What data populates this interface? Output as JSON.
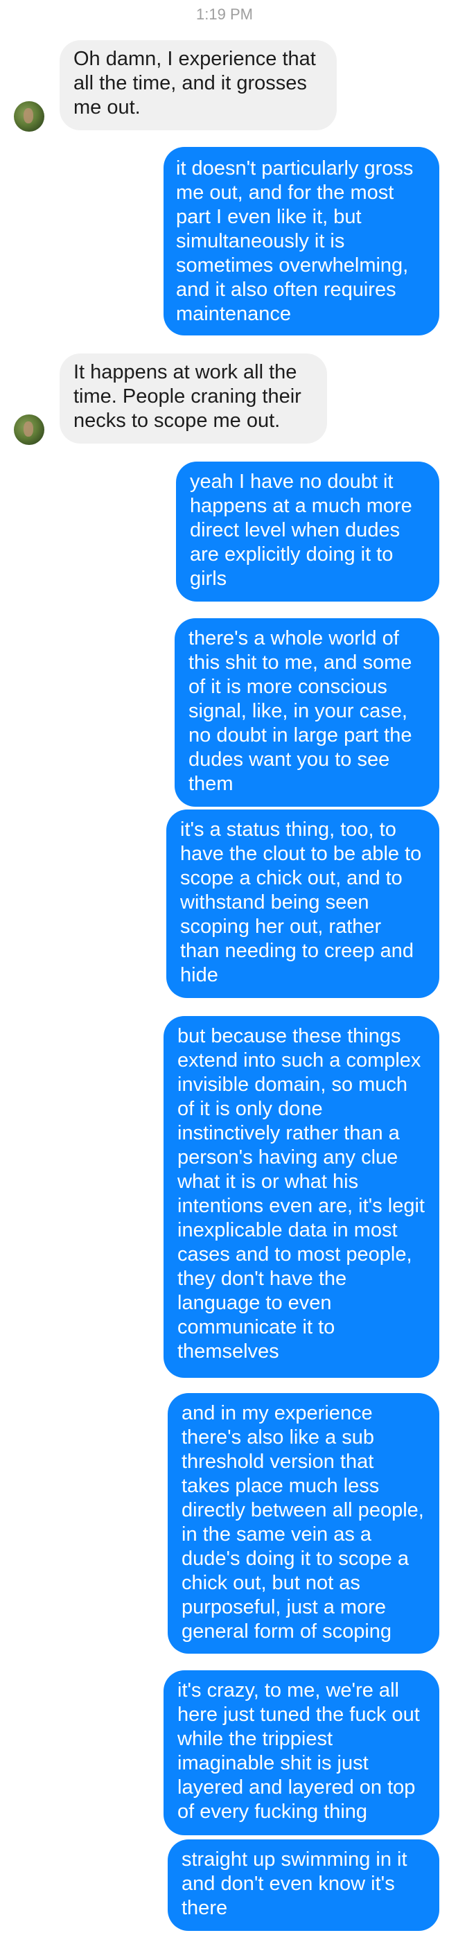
{
  "header": {
    "timestamp": "1:19 PM"
  },
  "messages": [
    {
      "sender": "them",
      "text": "Oh damn, I experience that all the time, and it grosses me out."
    },
    {
      "sender": "me",
      "text": "it doesn't particularly gross me out, and for the most part I even like it, but simultaneously it is sometimes overwhelming, and it also often requires maintenance"
    },
    {
      "sender": "them",
      "text": "It happens at work all the time. People craning their necks to scope me out."
    },
    {
      "sender": "me",
      "text": "yeah I have no doubt it happens at a much more direct level when dudes are explicitly doing it to girls"
    },
    {
      "sender": "me",
      "text": "there's a whole world of this shit to me, and some of it is more conscious signal, like, in your case, no doubt in large part the dudes want you to see them"
    },
    {
      "sender": "me",
      "text": "it's a status thing, too, to have the clout to be able to scope a chick out, and to withstand being seen scoping her out, rather than needing to creep and hide"
    },
    {
      "sender": "me",
      "text": "but because these things extend into such a complex invisible domain, so much of it is only done instinctively rather than a person's having any clue what it is or what his intentions even are, it's legit inexplicable data in most cases and to most people, they don't have the language to even communicate it to themselves"
    },
    {
      "sender": "me",
      "text": "and in my experience there's also like a sub threshold version that takes place much less directly between all people, in the same vein as a dude's doing it to scope a chick out, but not as purposeful, just a more general form of scoping"
    },
    {
      "sender": "me",
      "text": "it's crazy, to me, we're all here just tuned the fuck out while the trippiest imaginable shit is just layered and layered on top of every fucking thing"
    },
    {
      "sender": "me",
      "text": "straight up swimming in it and don't even know it's there"
    }
  ],
  "colors": {
    "outgoing_bubble": "#0b84fe",
    "incoming_bubble": "#f0f0f0",
    "timestamp_text": "#9e9e9e"
  },
  "avatars": [
    {
      "icon": "contact-avatar-photo"
    },
    {
      "icon": "contact-avatar-photo"
    }
  ]
}
